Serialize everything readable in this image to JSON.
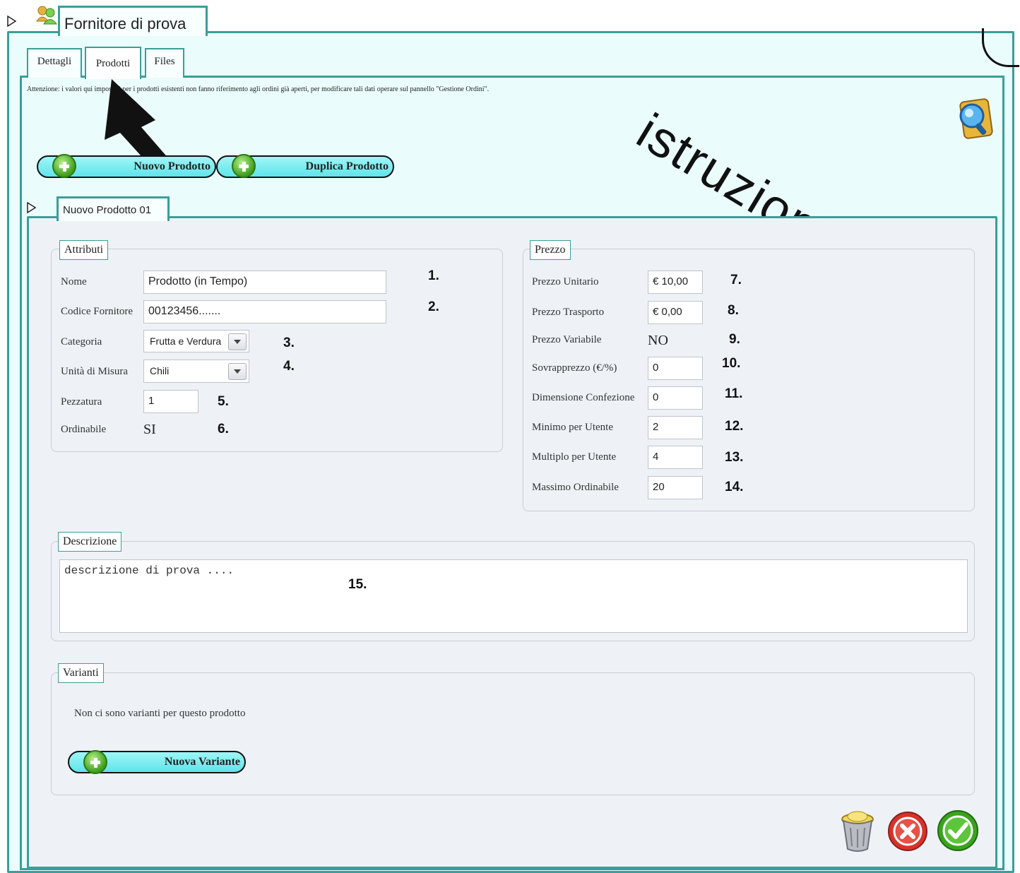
{
  "window": {
    "title": "Fornitore di prova",
    "tabs": [
      {
        "label": "Dettagli"
      },
      {
        "label": "Prodotti"
      },
      {
        "label": "Files"
      }
    ]
  },
  "notice": "Attenzione: i valori qui impostati per i prodotti esistenti non fanno riferimento agli ordini già aperti, per modificare tali dati operare sul pannello \"Gestione Ordini\".",
  "toolbar": {
    "new_product_label": "Nuovo Prodotto",
    "duplicate_product_label": "Duplica Prodotto"
  },
  "annotation": {
    "istruzioni": "istruzioni"
  },
  "product": {
    "tab_label": "Nuovo Prodotto 01",
    "attributi": {
      "legend": "Attributi",
      "nome_label": "Nome",
      "nome_value": "Prodotto (in Tempo)",
      "codice_label": "Codice Fornitore",
      "codice_value": "00123456.......",
      "categoria_label": "Categoria",
      "categoria_value": "Frutta e Verdura",
      "unita_label": "Unità di Misura",
      "unita_value": "Chili",
      "pezzatura_label": "Pezzatura",
      "pezzatura_value": "1",
      "ordinabile_label": "Ordinabile",
      "ordinabile_value": "SI"
    },
    "prezzo": {
      "legend": "Prezzo",
      "unitario_label": "Prezzo Unitario",
      "unitario_value": "€ 10,00",
      "trasporto_label": "Prezzo Trasporto",
      "trasporto_value": "€ 0,00",
      "variabile_label": "Prezzo Variabile",
      "variabile_value": "NO",
      "sovrapprezzo_label": "Sovrapprezzo (€/%)",
      "sovrapprezzo_value": "0",
      "confezione_label": "Dimensione Confezione",
      "confezione_value": "0",
      "minimo_label": "Minimo per Utente",
      "minimo_value": "2",
      "multiplo_label": "Multiplo per Utente",
      "multiplo_value": "4",
      "massimo_label": "Massimo Ordinabile",
      "massimo_value": "20"
    },
    "descrizione": {
      "legend": "Descrizione",
      "value": "descrizione di prova ...."
    },
    "varianti": {
      "legend": "Varianti",
      "empty_text": "Non ci sono varianti per questo prodotto",
      "new_variant_label": "Nuova Variante"
    }
  },
  "markers": {
    "m1": "1.",
    "m2": "2.",
    "m3": "3.",
    "m4": "4.",
    "m5": "5.",
    "m6": "6.",
    "m7": "7.",
    "m8": "8.",
    "m9": "9.",
    "m10": "10.",
    "m11": "11.",
    "m12": "12.",
    "m13": "13.",
    "m14": "14.",
    "m15": "15."
  },
  "icons": {
    "supplier": "supplier-group-icon",
    "help": "help-search-icon",
    "trash": "trash-icon",
    "cancel": "cancel-icon",
    "confirm": "confirm-icon"
  },
  "colors": {
    "frame": "#3a9e99",
    "panel_bg": "#eafcfc",
    "inner_bg": "#eef2f7",
    "button_fill": "#5fe4ea"
  }
}
